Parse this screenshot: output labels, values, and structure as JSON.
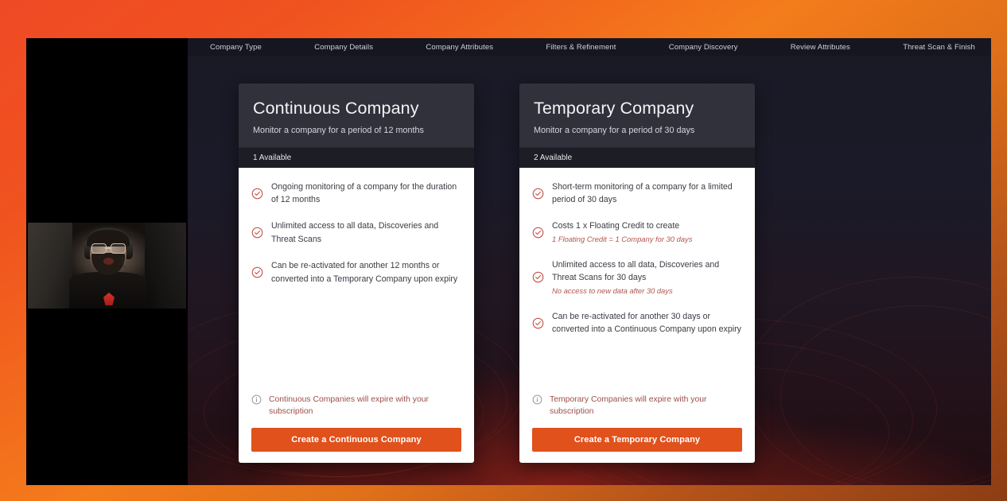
{
  "stepnav": {
    "steps": [
      {
        "label": "Company Type"
      },
      {
        "label": "Company Details"
      },
      {
        "label": "Company Attributes"
      },
      {
        "label": "Filters & Refinement"
      },
      {
        "label": "Company Discovery"
      },
      {
        "label": "Review Attributes"
      },
      {
        "label": "Threat Scan & Finish"
      }
    ]
  },
  "colors": {
    "frame_orange_top": "#f47c1b",
    "frame_orange_left": "#ef4a26",
    "cta_orange": "#e0511c",
    "check_red": "#c4544a",
    "note_red": "#b2564d",
    "card_header_dark": "#31313c",
    "avail_bar_dark": "#1d1d26"
  },
  "cards": [
    {
      "id": "continuous",
      "title": "Continuous Company",
      "subtitle": "Monitor a company for a period of 12 months",
      "availability": "1 Available",
      "features": [
        {
          "text": "Ongoing monitoring of a company for the duration of 12 months",
          "note": ""
        },
        {
          "text": "Unlimited access to all data, Discoveries and Threat Scans",
          "note": ""
        },
        {
          "text": "Can be re-activated for another 12 months or converted into a Temporary Company upon expiry",
          "note": ""
        }
      ],
      "expiry_note": "Continuous Companies will expire with your subscription",
      "cta_label": "Create a Continuous Company"
    },
    {
      "id": "temporary",
      "title": "Temporary Company",
      "subtitle": "Monitor a company for a period of 30 days",
      "availability": "2 Available",
      "features": [
        {
          "text": "Short-term monitoring of a company for a limited period of 30 days",
          "note": ""
        },
        {
          "text": "Costs 1 x Floating Credit to create",
          "note": "1 Floating Credit = 1 Company for 30 days"
        },
        {
          "text": "Unlimited access to all data, Discoveries and Threat Scans for 30 days",
          "note": "No access to new data after 30 days"
        },
        {
          "text": "Can be re-activated for another 30 days or converted into a Continuous Company upon expiry",
          "note": ""
        }
      ],
      "expiry_note": "Temporary Companies will expire with your subscription",
      "cta_label": "Create a Temporary Company"
    }
  ],
  "icons": {
    "check_circle": "check-circle-icon",
    "info_circle": "info-circle-icon"
  }
}
